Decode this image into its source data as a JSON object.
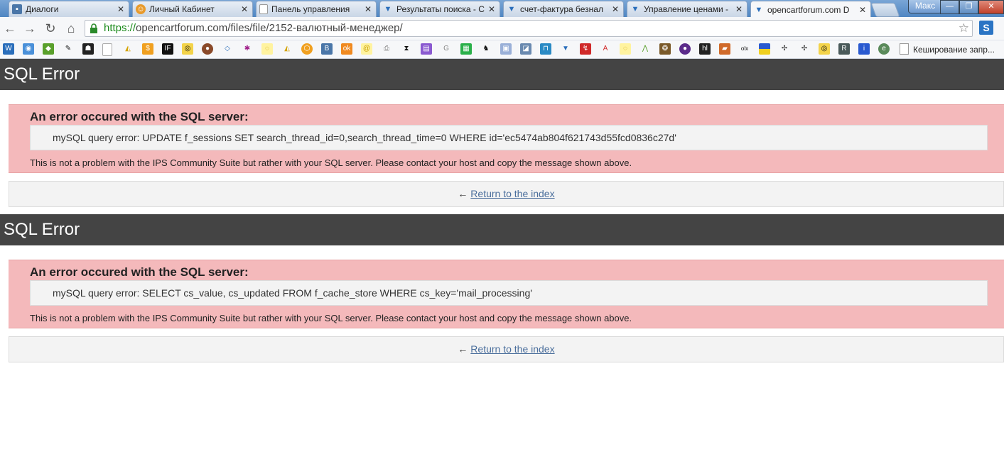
{
  "tabs": [
    {
      "label": "Диалоги",
      "icon": "vk-icon",
      "color": "#4a76a8"
    },
    {
      "label": "Личный Кабинет",
      "icon": "cabinet-icon",
      "color": "#e89a2c"
    },
    {
      "label": "Панель управления",
      "icon": "page-icon",
      "color": "#ffffff"
    },
    {
      "label": "Результаты поиска - С",
      "icon": "opencart-icon",
      "color": "#2a6ebb"
    },
    {
      "label": "счет-фактура безнал",
      "icon": "opencart-icon",
      "color": "#2a6ebb"
    },
    {
      "label": "Управление ценами -",
      "icon": "opencart-icon",
      "color": "#2a6ebb"
    },
    {
      "label": "opencartforum.com D",
      "icon": "opencart-icon",
      "color": "#2a6ebb",
      "active": true
    }
  ],
  "profile_name": "Макс",
  "address_bar": {
    "scheme": "https://",
    "rest": "opencartforum.com/files/file/2152-валютный-менеджер/"
  },
  "bookmarks_last_label": "Кеширование запр...",
  "errors": [
    {
      "header": "SQL Error",
      "title": "An error occured with the SQL server:",
      "query": "mySQL query error: UPDATE f_sessions SET search_thread_id=0,search_thread_time=0 WHERE id='ec5474ab804f621743d55fcd0836c27d'",
      "note": "This is not a problem with the IPS Community Suite but rather with your SQL server. Please contact your host and copy the message shown above.",
      "return_arrow": "←",
      "return_label": "Return to the index"
    },
    {
      "header": "SQL Error",
      "title": "An error occured with the SQL server:",
      "query": "mySQL query error: SELECT cs_value, cs_updated FROM f_cache_store WHERE cs_key='mail_processing'",
      "note": "This is not a problem with the IPS Community Suite but rather with your SQL server. Please contact your host and copy the message shown above.",
      "return_arrow": "←",
      "return_label": "Return to the index"
    }
  ],
  "colors": {
    "header_bg": "#444444",
    "error_bg": "#f4b9bb",
    "query_bg": "#f3f3f3",
    "link": "#4a6e9c"
  }
}
